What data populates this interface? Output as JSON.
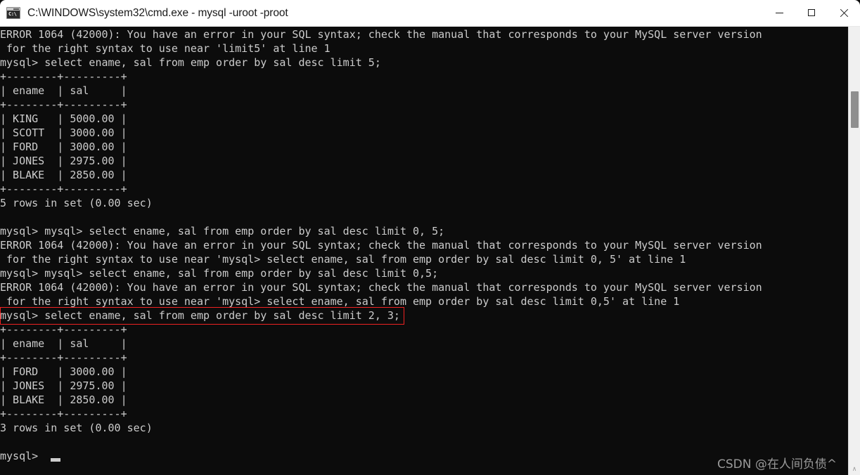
{
  "window": {
    "title": "C:\\WINDOWS\\system32\\cmd.exe - mysql  -uroot -proot",
    "icon": "cmd-console-icon",
    "icon_text": "C:\\",
    "background": "#0c0c0c",
    "text_color": "#cccccc",
    "controls": {
      "minimize": "—",
      "maximize": "□",
      "close": "✕"
    }
  },
  "terminal": {
    "lines": [
      "ERROR 1064 (42000): You have an error in your SQL syntax; check the manual that corresponds to your MySQL server version",
      " for the right syntax to use near 'limit5' at line 1",
      "mysql> select ename, sal from emp order by sal desc limit 5;",
      "+--------+---------+",
      "| ename  | sal     |",
      "+--------+---------+",
      "| KING   | 5000.00 |",
      "| SCOTT  | 3000.00 |",
      "| FORD   | 3000.00 |",
      "| JONES  | 2975.00 |",
      "| BLAKE  | 2850.00 |",
      "+--------+---------+",
      "5 rows in set (0.00 sec)",
      "",
      "mysql> mysql> select ename, sal from emp order by sal desc limit 0, 5;",
      "ERROR 1064 (42000): You have an error in your SQL syntax; check the manual that corresponds to your MySQL server version",
      " for the right syntax to use near 'mysql> select ename, sal from emp order by sal desc limit 0, 5' at line 1",
      "mysql> mysql> select ename, sal from emp order by sal desc limit 0,5;",
      "ERROR 1064 (42000): You have an error in your SQL syntax; check the manual that corresponds to your MySQL server version",
      " for the right syntax to use near 'mysql> select ename, sal from emp order by sal desc limit 0,5' at line 1",
      "mysql> select ename, sal from emp order by sal desc limit 2, 3;",
      "+--------+---------+",
      "| ename  | sal     |",
      "+--------+---------+",
      "| FORD   | 3000.00 |",
      "| JONES  | 2975.00 |",
      "| BLAKE  | 2850.00 |",
      "+--------+---------+",
      "3 rows in set (0.00 sec)",
      "",
      "mysql>"
    ],
    "highlight": {
      "line_index": 20,
      "label": "highlighted-sql-command",
      "text": "mysql> select ename, sal from emp order by sal desc limit 2, 3;",
      "color": "#ee2222"
    },
    "cursor": {
      "line_index": 30,
      "column": 8
    }
  },
  "result_tables": [
    {
      "name": "limit-5-result",
      "columns": [
        "ename",
        "sal"
      ],
      "rows": [
        [
          "KING",
          "5000.00"
        ],
        [
          "SCOTT",
          "3000.00"
        ],
        [
          "FORD",
          "3000.00"
        ],
        [
          "JONES",
          "2975.00"
        ],
        [
          "BLAKE",
          "2850.00"
        ]
      ],
      "status": "5 rows in set (0.00 sec)"
    },
    {
      "name": "limit-2-3-result",
      "columns": [
        "ename",
        "sal"
      ],
      "rows": [
        [
          "FORD",
          "3000.00"
        ],
        [
          "JONES",
          "2975.00"
        ],
        [
          "BLAKE",
          "2850.00"
        ]
      ],
      "status": "3 rows in set (0.00 sec)"
    }
  ],
  "watermark": {
    "text": "CSDN @在人间负债^"
  },
  "scrollbar": {
    "down_arrow": "∧"
  }
}
